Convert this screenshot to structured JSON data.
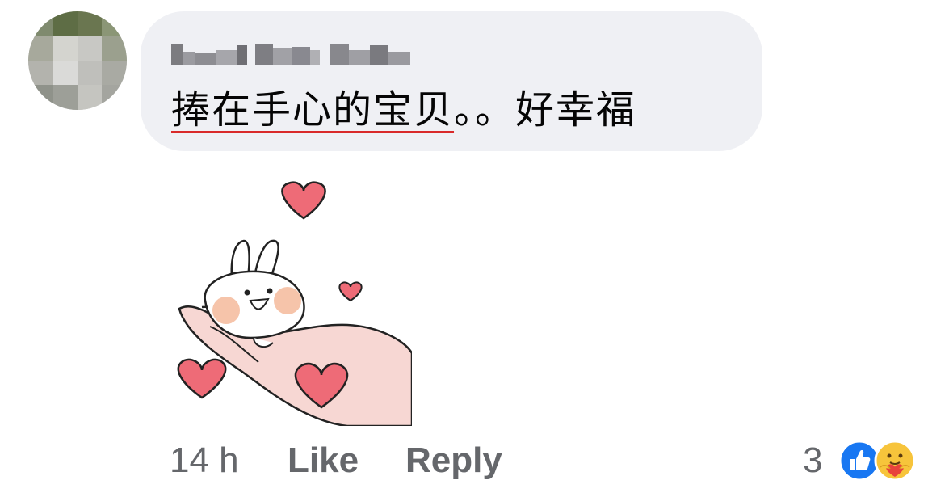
{
  "comment": {
    "text_underlined": "捧在手心的宝贝",
    "text_rest": "。。好幸福",
    "author_name_blurred": "Lee Hui Chen"
  },
  "actions": {
    "time": "14 h",
    "like_label": "Like",
    "reply_label": "Reply"
  },
  "reactions": {
    "count": "3",
    "icons": [
      "like-icon",
      "care-icon"
    ]
  },
  "sticker": {
    "description_icon": "bunny-in-hand-with-hearts"
  },
  "colors": {
    "bubble": "#eff0f4",
    "meta_text": "#65676b",
    "text": "#050505",
    "spellcheck_underline": "#d92a2a",
    "like_blue": "#1877f2",
    "heart": "#ef6b78"
  }
}
